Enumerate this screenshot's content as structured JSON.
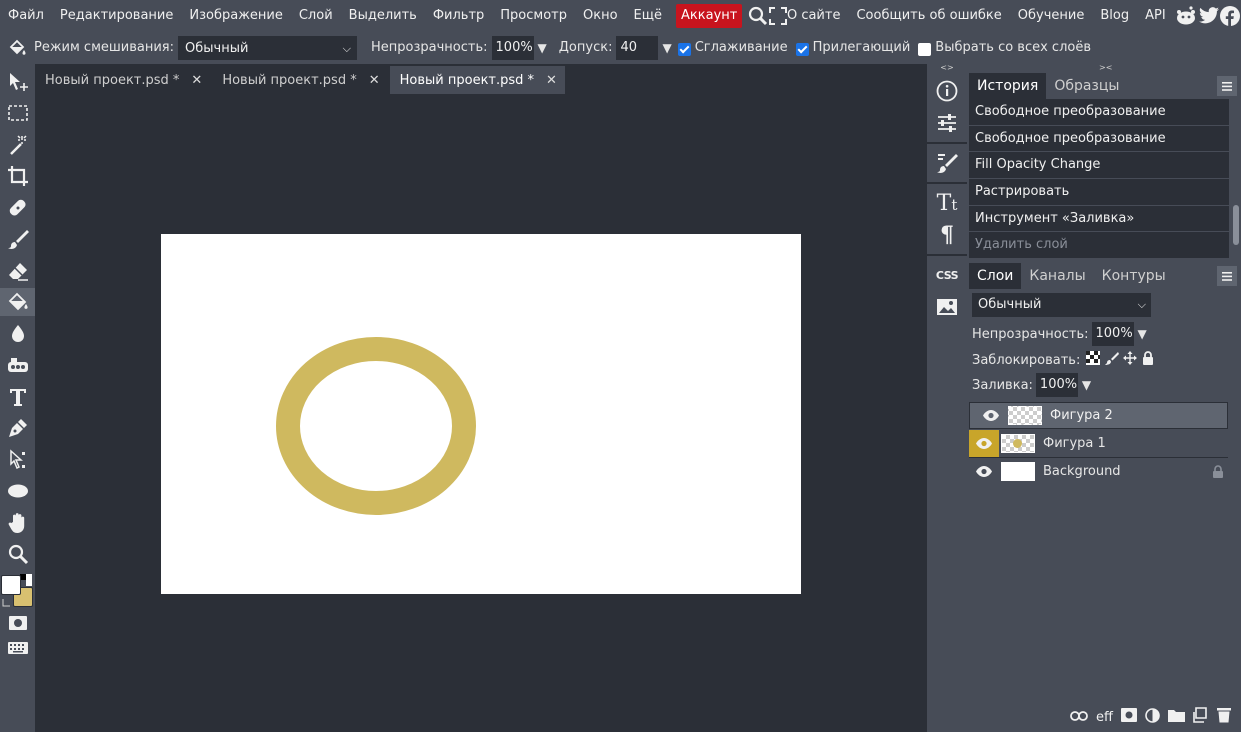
{
  "menu": {
    "items": [
      "Файл",
      "Редактирование",
      "Изображение",
      "Слой",
      "Выделить",
      "Фильтр",
      "Просмотр",
      "Окно",
      "Ещё"
    ],
    "account": "Аккаунт",
    "about": "О сайте",
    "report": "Сообщить об ошибке",
    "learn": "Обучение",
    "blog": "Blog",
    "api": "API"
  },
  "options": {
    "blend_label": "Режим смешивания:",
    "blend_value": "Обычный",
    "opacity_label": "Непрозрачность:",
    "opacity_value": "100%",
    "tolerance_label": "Допуск:",
    "tolerance_value": "40",
    "antialias_label": "Сглаживание",
    "contiguous_label": "Прилегающий",
    "all_layers_label": "Выбрать со всех слоёв",
    "antialias_checked": true,
    "contiguous_checked": true,
    "all_layers_checked": false
  },
  "tabs": [
    {
      "label": "Новый проект.psd *"
    },
    {
      "label": "Новый проект.psd *"
    },
    {
      "label": "Новый проект.psd *"
    }
  ],
  "colors": {
    "ring": "#cfb95f",
    "foreground": "#ffffff",
    "background_swatch": "#d8c070",
    "accent_yellow": "#c8a52a",
    "account_red": "#c8141e"
  },
  "history": {
    "tabs": [
      "История",
      "Образцы"
    ],
    "items": [
      "Свободное преобразование",
      "Свободное преобразование",
      "Fill Opacity Change",
      "Растрировать",
      "Инструмент «Заливка»",
      "Удалить слой"
    ]
  },
  "layers": {
    "tabs": [
      "Слои",
      "Каналы",
      "Контуры"
    ],
    "blend_value": "Обычный",
    "opacity_label": "Непрозрачность:",
    "opacity_value": "100%",
    "lock_label": "Заблокировать:",
    "fill_label": "Заливка:",
    "fill_value": "100%",
    "items": [
      {
        "name": "Фигура 2"
      },
      {
        "name": "Фигура 1"
      },
      {
        "name": "Background"
      }
    ]
  },
  "strip": {
    "css": "CSS"
  },
  "lbottom": {
    "effects": "eff"
  }
}
